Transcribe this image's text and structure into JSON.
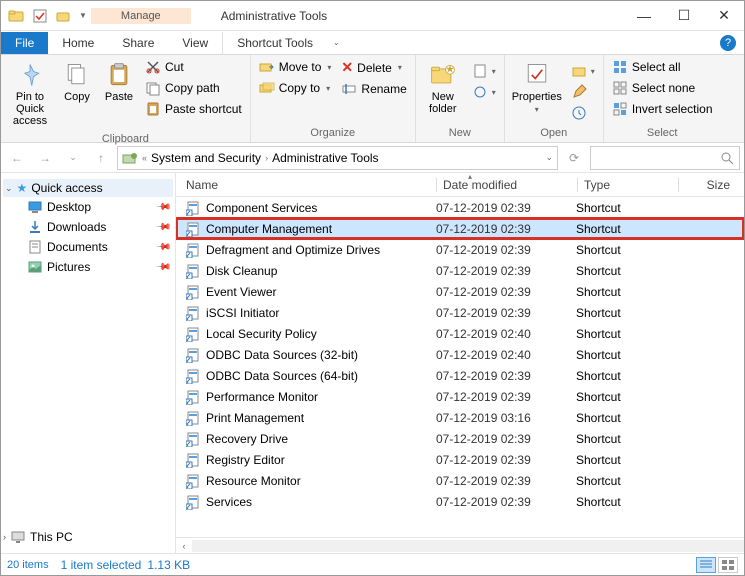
{
  "titlebar": {
    "context_tab": "Manage",
    "title": "Administrative Tools"
  },
  "tabs": {
    "file": "File",
    "home": "Home",
    "share": "Share",
    "view": "View",
    "shortcut_tools": "Shortcut Tools"
  },
  "ribbon": {
    "clipboard": {
      "label": "Clipboard",
      "pin": "Pin to Quick access",
      "copy": "Copy",
      "paste": "Paste",
      "cut": "Cut",
      "copy_path": "Copy path",
      "paste_shortcut": "Paste shortcut"
    },
    "organize": {
      "label": "Organize",
      "move_to": "Move to",
      "copy_to": "Copy to",
      "delete": "Delete",
      "rename": "Rename"
    },
    "new": {
      "label": "New",
      "new_folder": "New folder"
    },
    "open": {
      "label": "Open",
      "properties": "Properties"
    },
    "select": {
      "label": "Select",
      "select_all": "Select all",
      "select_none": "Select none",
      "invert": "Invert selection"
    }
  },
  "breadcrumb": {
    "segment1": "System and Security",
    "segment2": "Administrative Tools"
  },
  "columns": {
    "name": "Name",
    "date": "Date modified",
    "type": "Type",
    "size": "Size"
  },
  "nav": {
    "quick_access": "Quick access",
    "desktop": "Desktop",
    "downloads": "Downloads",
    "documents": "Documents",
    "pictures": "Pictures",
    "this_pc": "This PC"
  },
  "files": [
    {
      "name": "Component Services",
      "date": "07-12-2019 02:39",
      "type": "Shortcut"
    },
    {
      "name": "Computer Management",
      "date": "07-12-2019 02:39",
      "type": "Shortcut",
      "selected": true,
      "highlighted": true
    },
    {
      "name": "Defragment and Optimize Drives",
      "date": "07-12-2019 02:39",
      "type": "Shortcut"
    },
    {
      "name": "Disk Cleanup",
      "date": "07-12-2019 02:39",
      "type": "Shortcut"
    },
    {
      "name": "Event Viewer",
      "date": "07-12-2019 02:39",
      "type": "Shortcut"
    },
    {
      "name": "iSCSI Initiator",
      "date": "07-12-2019 02:39",
      "type": "Shortcut"
    },
    {
      "name": "Local Security Policy",
      "date": "07-12-2019 02:40",
      "type": "Shortcut"
    },
    {
      "name": "ODBC Data Sources (32-bit)",
      "date": "07-12-2019 02:40",
      "type": "Shortcut"
    },
    {
      "name": "ODBC Data Sources (64-bit)",
      "date": "07-12-2019 02:39",
      "type": "Shortcut"
    },
    {
      "name": "Performance Monitor",
      "date": "07-12-2019 02:39",
      "type": "Shortcut"
    },
    {
      "name": "Print Management",
      "date": "07-12-2019 03:16",
      "type": "Shortcut"
    },
    {
      "name": "Recovery Drive",
      "date": "07-12-2019 02:39",
      "type": "Shortcut"
    },
    {
      "name": "Registry Editor",
      "date": "07-12-2019 02:39",
      "type": "Shortcut"
    },
    {
      "name": "Resource Monitor",
      "date": "07-12-2019 02:39",
      "type": "Shortcut"
    },
    {
      "name": "Services",
      "date": "07-12-2019 02:39",
      "type": "Shortcut"
    }
  ],
  "status": {
    "count": "20 items",
    "selected": "1 item selected",
    "size": "1.13 KB"
  }
}
